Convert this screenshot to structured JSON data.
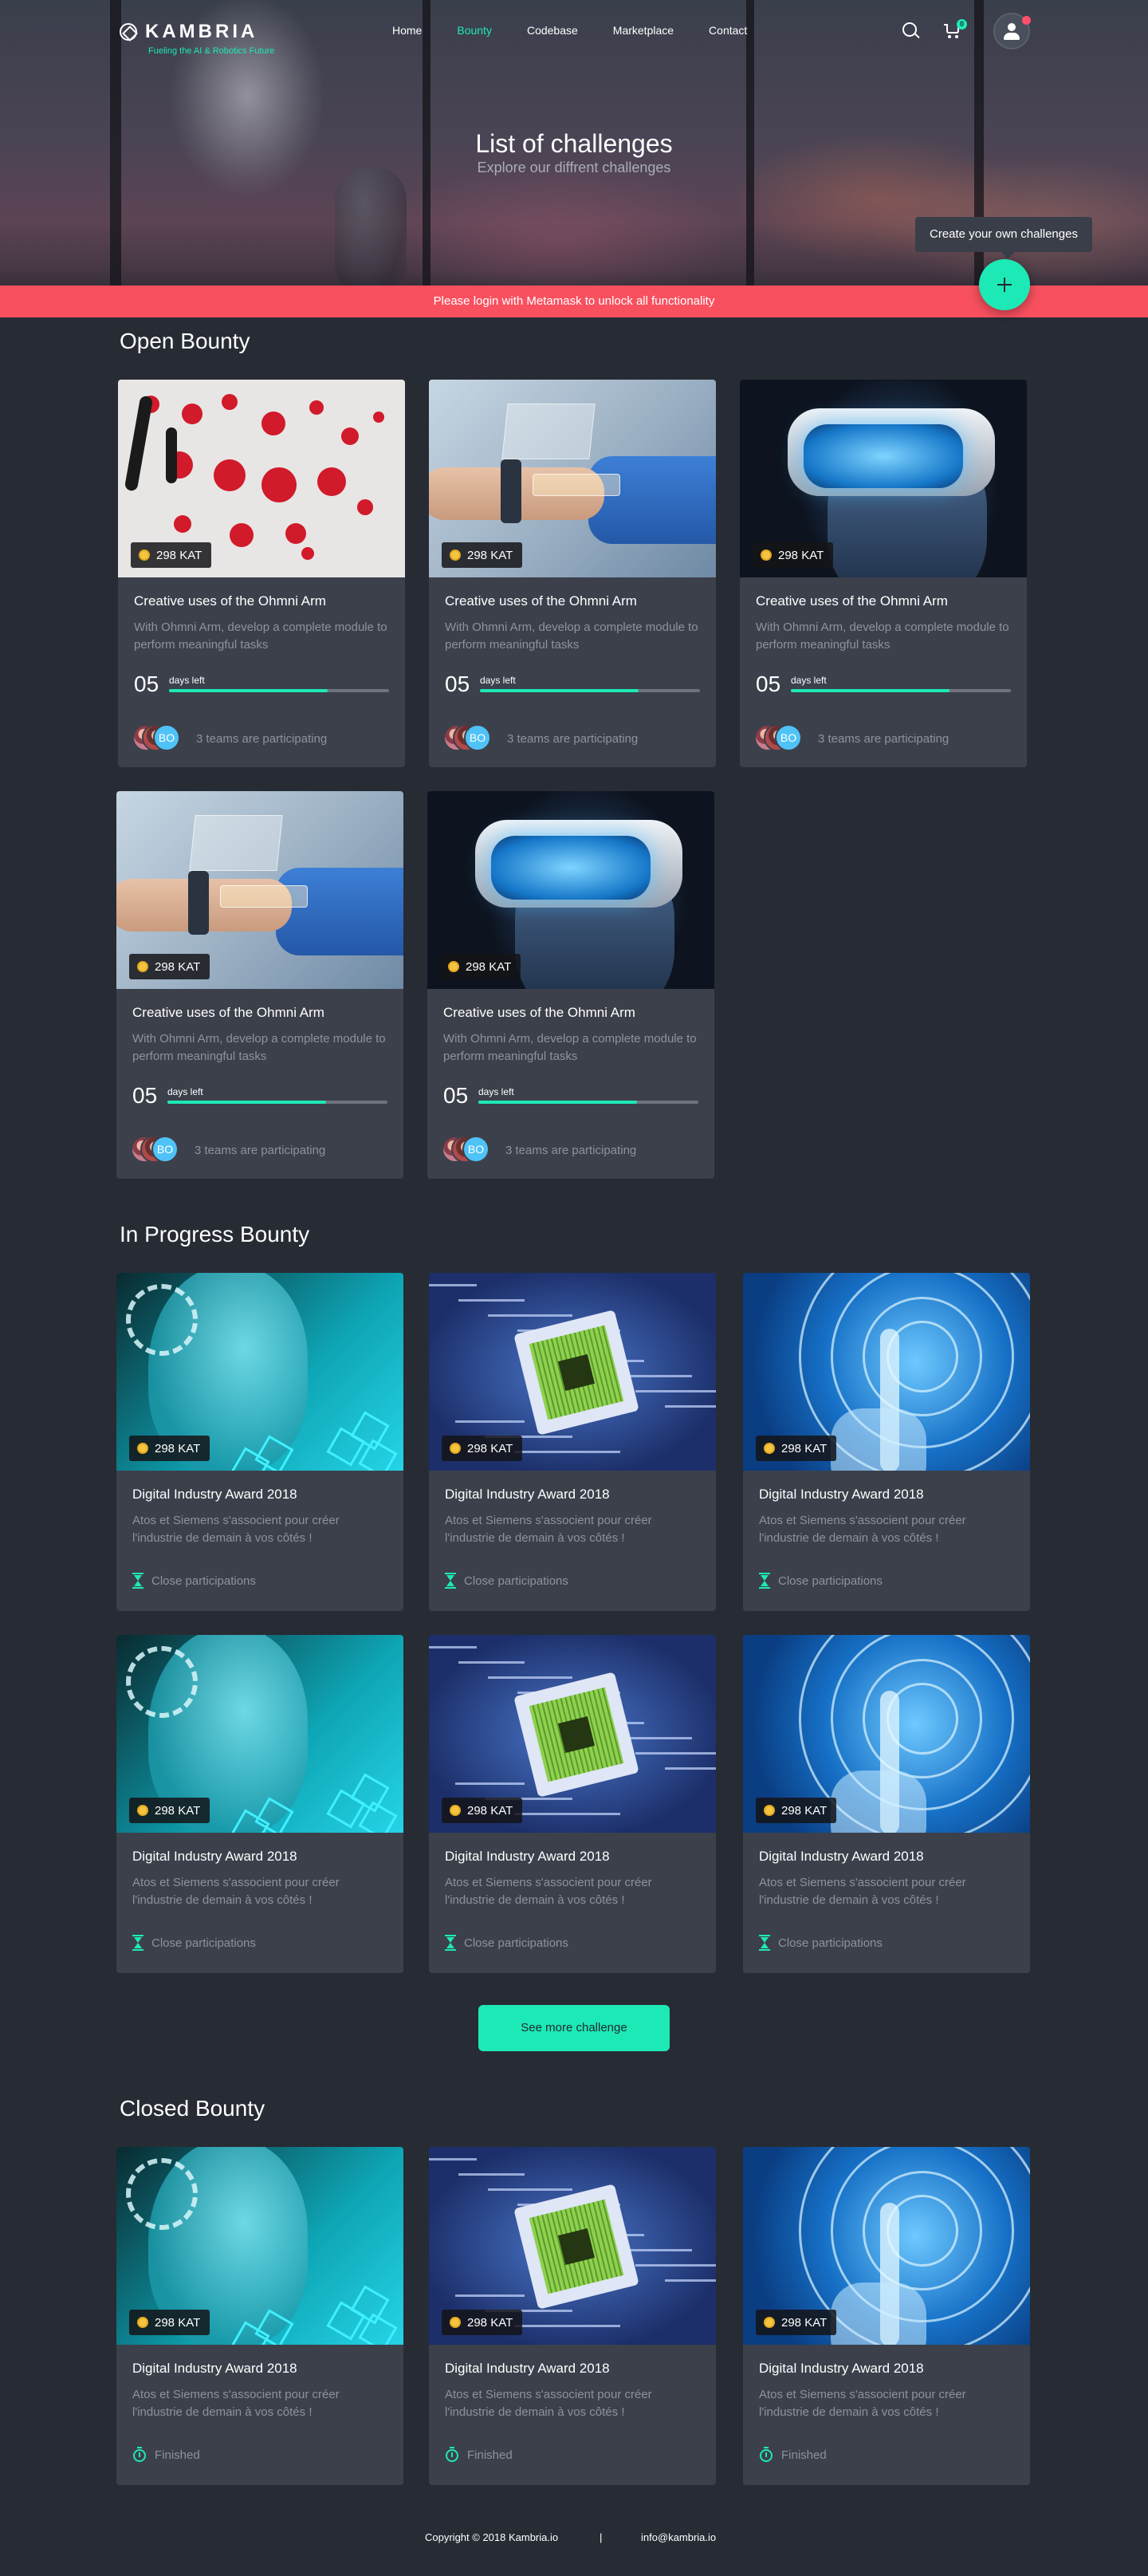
{
  "header": {
    "logo_text": "KAMBRIA",
    "logo_tagline": "Fueling the AI & Robotics Future",
    "nav": [
      {
        "label": "Home",
        "active": false
      },
      {
        "label": "Bounty",
        "active": true
      },
      {
        "label": "Codebase",
        "active": false
      },
      {
        "label": "Marketplace",
        "active": false
      },
      {
        "label": "Contact",
        "active": false
      }
    ],
    "cart_count": "0",
    "accent_color": "#1de9b6"
  },
  "hero": {
    "title": "List of challenges",
    "subtitle": "Explore our diffrent challenges",
    "create_tooltip": "Create your own challenges",
    "alert": "Please login with Metamask to unlock all functionality"
  },
  "open_bounty": {
    "title": "Open Bounty",
    "cards": [
      {
        "image": "robot-parts",
        "price": "298 KAT",
        "title": "Creative uses of the Ohmni Arm",
        "description": "With Ohmni Arm, develop a complete module to perform meaningful tasks",
        "days": "05",
        "days_label": "days left",
        "progress": 0.72,
        "avatar_initials": "BO",
        "teams": "3 teams are participating"
      },
      {
        "image": "holo-arm",
        "price": "298 KAT",
        "title": "Creative uses of the Ohmni Arm",
        "description": "With Ohmni Arm, develop a complete module to perform meaningful tasks",
        "days": "05",
        "days_label": "days left",
        "progress": 0.72,
        "avatar_initials": "BO",
        "teams": "3 teams are participating"
      },
      {
        "image": "vr-headset",
        "price": "298 KAT",
        "title": "Creative uses of the Ohmni Arm",
        "description": "With Ohmni Arm, develop a complete module to perform meaningful tasks",
        "days": "05",
        "days_label": "days left",
        "progress": 0.72,
        "avatar_initials": "BO",
        "teams": "3 teams are participating"
      },
      {
        "image": "holo-arm",
        "price": "298 KAT",
        "title": "Creative uses of the Ohmni Arm",
        "description": "With Ohmni Arm, develop a complete module to perform meaningful tasks",
        "days": "05",
        "days_label": "days left",
        "progress": 0.72,
        "avatar_initials": "BO",
        "teams": "3 teams are participating"
      },
      {
        "image": "vr-headset",
        "price": "298 KAT",
        "title": "Creative uses of the Ohmni Arm",
        "description": "With Ohmni Arm, develop a complete module to perform meaningful tasks",
        "days": "05",
        "days_label": "days left",
        "progress": 0.72,
        "avatar_initials": "BO",
        "teams": "3 teams are participating"
      }
    ]
  },
  "in_progress_bounty": {
    "title": "In Progress Bounty",
    "cards": [
      {
        "image": "ai-head",
        "price": "298 KAT",
        "title": "Digital Industry Award 2018",
        "description": "Atos et Siemens s'associent pour créer l'industrie de demain à vos côtés !",
        "status": "Close participations"
      },
      {
        "image": "chip",
        "price": "298 KAT",
        "title": "Digital Industry Award 2018",
        "description": "Atos et Siemens s'associent pour créer l'industrie de demain à vos côtés !",
        "status": "Close participations"
      },
      {
        "image": "touch-hand",
        "price": "298 KAT",
        "title": "Digital Industry Award 2018",
        "description": "Atos et Siemens s'associent pour créer l'industrie de demain à vos côtés !",
        "status": "Close participations"
      },
      {
        "image": "ai-head",
        "price": "298 KAT",
        "title": "Digital Industry Award 2018",
        "description": "Atos et Siemens s'associent pour créer l'industrie de demain à vos côtés !",
        "status": "Close participations"
      },
      {
        "image": "chip",
        "price": "298 KAT",
        "title": "Digital Industry Award 2018",
        "description": "Atos et Siemens s'associent pour créer l'industrie de demain à vos côtés !",
        "status": "Close participations"
      },
      {
        "image": "touch-hand",
        "price": "298 KAT",
        "title": "Digital Industry Award 2018",
        "description": "Atos et Siemens s'associent pour créer l'industrie de demain à vos côtés !",
        "status": "Close participations"
      }
    ],
    "more_button": "See more challenge"
  },
  "closed_bounty": {
    "title": "Closed Bounty",
    "cards": [
      {
        "image": "ai-head",
        "price": "298 KAT",
        "title": "Digital Industry Award 2018",
        "description": "Atos et Siemens s'associent pour créer l'industrie de demain à vos côtés !",
        "status": "Finished"
      },
      {
        "image": "chip",
        "price": "298 KAT",
        "title": "Digital Industry Award 2018",
        "description": "Atos et Siemens s'associent pour créer l'industrie de demain à vos côtés !",
        "status": "Finished"
      },
      {
        "image": "touch-hand",
        "price": "298 KAT",
        "title": "Digital Industry Award 2018",
        "description": "Atos et Siemens s'associent pour créer l'industrie de demain à vos côtés !",
        "status": "Finished"
      }
    ]
  },
  "footer": {
    "copyright": "Copyright © 2018 Kambria.io",
    "separator": "|",
    "email": "info@kambria.io"
  }
}
